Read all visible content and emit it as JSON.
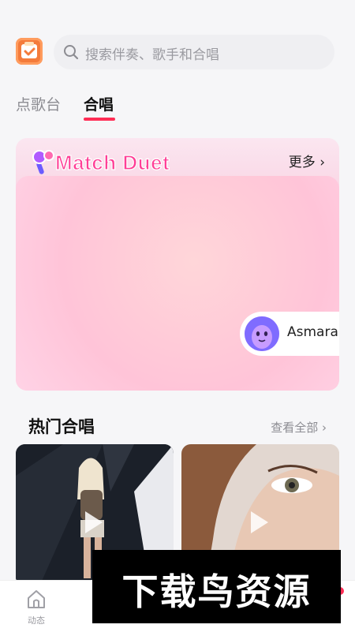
{
  "search": {
    "placeholder": "搜索伴奏、歌手和合唱"
  },
  "tabs": [
    {
      "label": "点歌台"
    },
    {
      "label": "合唱"
    }
  ],
  "duet_card": {
    "title": "Match Duet",
    "more_label": "更多 ›",
    "user_name": "Asmara"
  },
  "hot_section": {
    "title": "热门合唱",
    "see_all_label": "查看全部 ›"
  },
  "bottom_nav": {
    "feed_label": "动态"
  },
  "watermark": {
    "text": "下载鸟资源"
  },
  "colors": {
    "accent": "#ff2d55",
    "brand_orange": "#f47b3b",
    "match_title": "#ff3e96"
  },
  "icons": [
    "calendar-check-icon",
    "search-icon",
    "microphone-icon",
    "play-icon",
    "home-icon"
  ]
}
